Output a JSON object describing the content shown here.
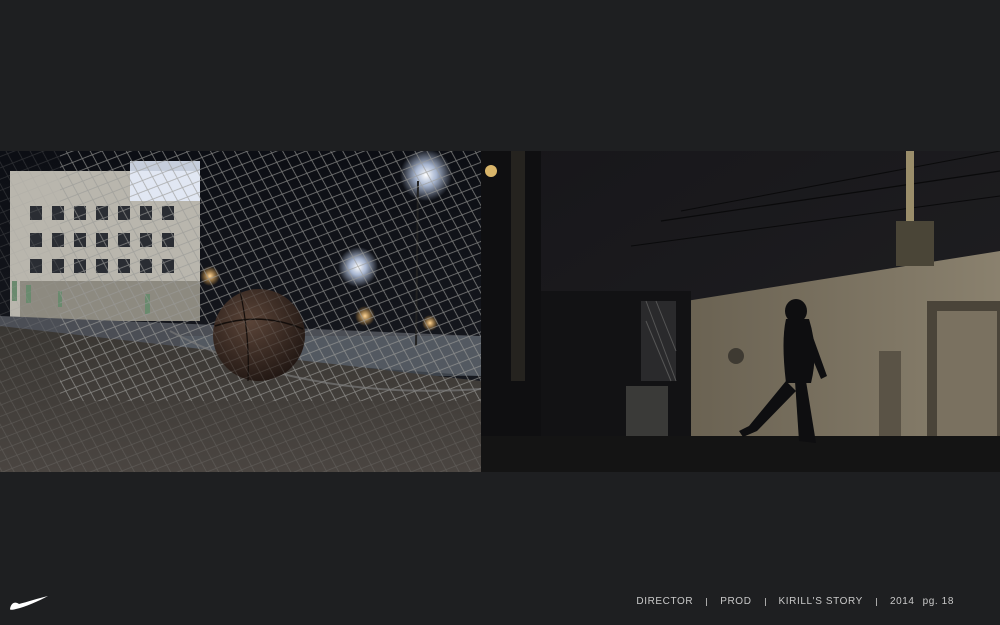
{
  "footer": {
    "items": [
      "DIRECTOR",
      "PROD",
      "KIRILL'S STORY",
      "2014"
    ],
    "page_label": "pg. 18"
  },
  "brand": {
    "logo": "nike-swoosh-icon",
    "color": "#ffffff"
  },
  "colors": {
    "background": "#1e1f21",
    "footer_text": "#c9c9c9"
  }
}
